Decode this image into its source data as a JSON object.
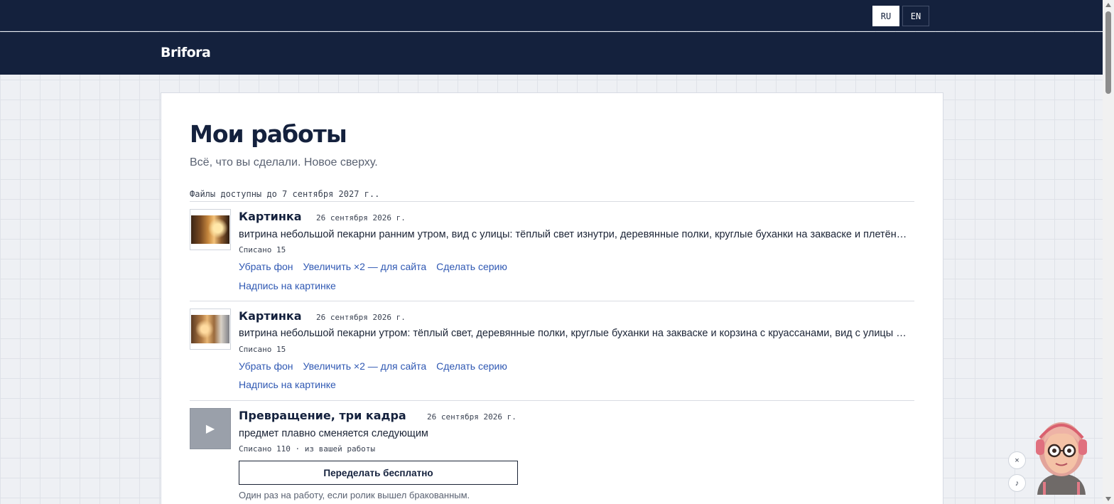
{
  "language_switcher": {
    "ru": "RU",
    "en": "EN",
    "active": "RU"
  },
  "header": {
    "logo": "Brifora"
  },
  "page": {
    "title": "Мои работы",
    "subtitle": "Всё, что вы сделали. Новое сверху.",
    "files_note": "Файлы доступны до 7 сентября 2027 г.."
  },
  "works": [
    {
      "type": "image",
      "title": "Картинка",
      "date": "26 сентября 2026 г.",
      "description": "витрина небольшой пекарни ранним утром, вид с улицы: тёплый свет изнутри, деревянные полки, круглые буханки на закваске и плетёная корзина с круассанами",
      "meta": "Списано 15",
      "actions": [
        "Убрать фон",
        "Увеличить ×2 — для сайта",
        "Сделать серию"
      ],
      "extra_action": "Надпись на картинке"
    },
    {
      "type": "image",
      "title": "Картинка",
      "date": "26 сентября 2026 г.",
      "description": "витрина небольшой пекарни утром: тёплый свет, деревянные полки, круглые буханки на закваске и корзина с круассанами, вид с улицы через стекло",
      "meta": "Списано 15",
      "actions": [
        "Убрать фон",
        "Увеличить ×2 — для сайта",
        "Сделать серию"
      ],
      "extra_action": "Надпись на картинке"
    },
    {
      "type": "video",
      "title": "Превращение, три кадра",
      "date": "26 сентября 2026 г.",
      "description": "предмет плавно сменяется следующим",
      "meta": "Списано 110 · из вашей работы",
      "redo_button": "Переделать бесплатно",
      "redo_note": "Один раз на работу, если ролик вышел бракованным.",
      "play_icon": "▶"
    }
  ],
  "floating": {
    "close_icon": "×",
    "music_icon": "♪"
  }
}
